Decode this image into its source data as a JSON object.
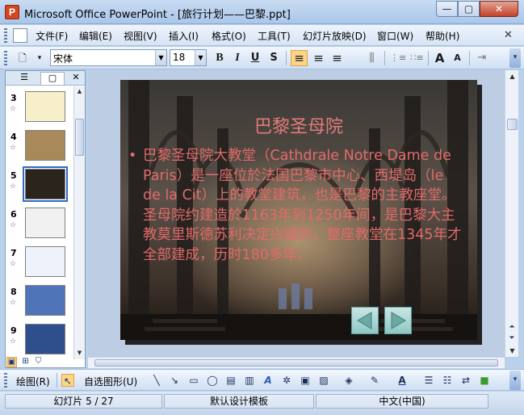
{
  "window": {
    "title": "Microsoft Office PowerPoint - [旅行计划——巴黎.ppt]",
    "min_glyph": "—",
    "max_glyph": "▢",
    "close_glyph": "✕",
    "app_icon_glyph": "P"
  },
  "menu": {
    "items": [
      "文件(F)",
      "编辑(E)",
      "视图(V)",
      "插入(I)",
      "格式(O)",
      "工具(T)",
      "幻灯片放映(D)",
      "窗口(W)",
      "帮助(H)"
    ],
    "close_glyph": "✕"
  },
  "format_toolbar": {
    "new_glyph": "🗋",
    "font_name": "宋体",
    "font_size": "18",
    "bold": "B",
    "italic": "I",
    "underline": "U",
    "shadow": "S",
    "align_left": "≡",
    "align_center": "≡",
    "align_right": "≡",
    "distributed": "⫼",
    "numbering": "⋮≡",
    "bullets": "∷≡",
    "grow_font": "A",
    "shrink_font": "A",
    "indent": "⇥",
    "overflow": "▾"
  },
  "outline_pane": {
    "tab_outline_glyph": "☰",
    "tab_slides_glyph": "▢",
    "close_glyph": "✕",
    "star_glyph": "☆",
    "slides": [
      {
        "num": "3",
        "selected": false,
        "bg": "#f6efc9"
      },
      {
        "num": "4",
        "selected": false,
        "bg": "#a88a5a"
      },
      {
        "num": "5",
        "selected": true,
        "bg": "#2a241d"
      },
      {
        "num": "6",
        "selected": false,
        "bg": "#f1f1f1"
      },
      {
        "num": "7",
        "selected": false,
        "bg": "#eef3fb"
      },
      {
        "num": "8",
        "selected": false,
        "bg": "#4f74b8"
      },
      {
        "num": "9",
        "selected": false,
        "bg": "#2f4f8c"
      }
    ]
  },
  "slide": {
    "title": "巴黎圣母院",
    "bullet": "•",
    "body": "巴黎圣母院大教堂（Cathdrale Notre Dame de Paris）是一座位於法国巴黎市中心、西堤岛（le de la Cit）上的教堂建筑，也是巴黎的主教座堂。圣母院约建造於1163年到1250年间，是巴黎大主教莫里斯德苏利决定兴建的，整座教堂在1345年才全部建成，历时180多年。",
    "prev_glyph": "◀",
    "next_glyph": "▶"
  },
  "draw_toolbar": {
    "draw_menu": "绘图(R)",
    "autoshapes_menu": "自选图形(U)",
    "icons": [
      "↖",
      "╲",
      "↘",
      "▭",
      "◯",
      "▤",
      "▥",
      "A",
      "✲",
      "▣",
      "▨",
      "◈",
      "✎",
      "A",
      "☰",
      "☷",
      "⇄",
      "■"
    ]
  },
  "status": {
    "slide_info": "幻灯片 5 / 27",
    "design": "默认设计模板",
    "language": "中文(中国)"
  }
}
